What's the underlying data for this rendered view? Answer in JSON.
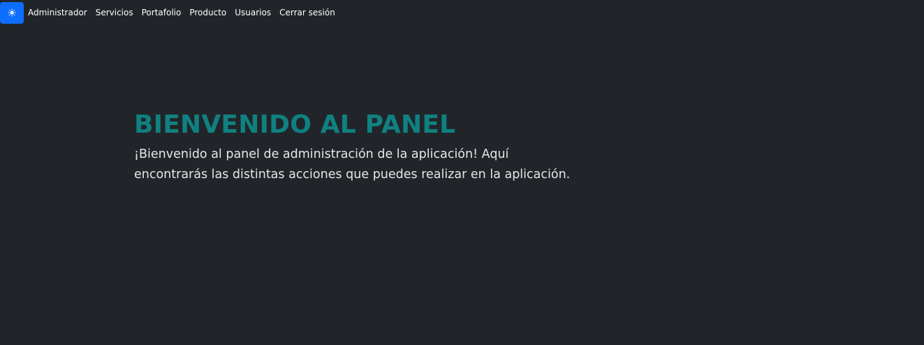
{
  "nav": {
    "theme_icon": "sun-icon",
    "accent_color": "#0d6efd",
    "items": [
      {
        "label": "Administrador"
      },
      {
        "label": "Servicios"
      },
      {
        "label": "Portafolio"
      },
      {
        "label": "Producto"
      },
      {
        "label": "Usuarios"
      },
      {
        "label": "Cerrar sesión"
      }
    ]
  },
  "hero": {
    "title": "BIENVENIDO AL PANEL",
    "title_color": "#108080",
    "text": "¡Bienvenido al panel de administración de la aplicación! Aquí encontrarás las distintas acciones que puedes realizar en la aplicación."
  },
  "colors": {
    "background": "#212529",
    "text": "#ffffff"
  }
}
